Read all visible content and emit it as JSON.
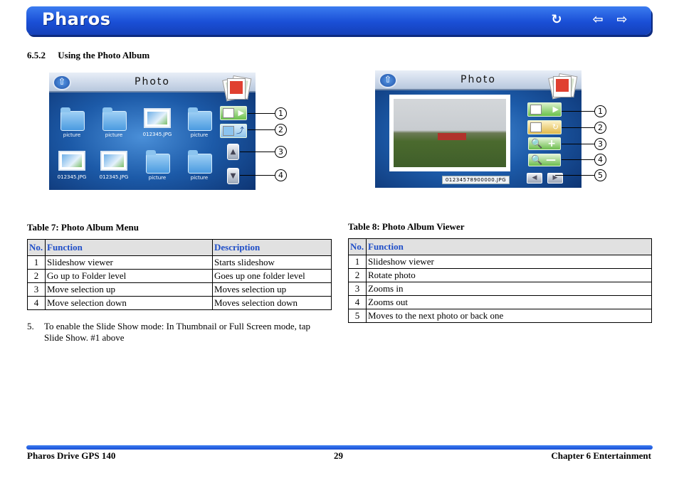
{
  "header": {
    "title": "Pharos",
    "icons": [
      "back-icon",
      "prev-page-icon",
      "next-page-icon"
    ]
  },
  "section": {
    "number": "6.5.2",
    "title": "Using the Photo Album"
  },
  "screen1": {
    "title": "Photo",
    "items": [
      {
        "type": "folder",
        "label": "picture"
      },
      {
        "type": "folder",
        "label": "picture"
      },
      {
        "type": "thumb",
        "label": "012345.JPG"
      },
      {
        "type": "folder",
        "label": "picture"
      },
      {
        "type": "thumb",
        "label": "012345.JPG"
      },
      {
        "type": "thumb",
        "label": "012345.JPG"
      },
      {
        "type": "folder",
        "label": "picture"
      },
      {
        "type": "folder",
        "label": "picture"
      }
    ],
    "callouts": [
      "1",
      "2",
      "3",
      "4"
    ]
  },
  "screen2": {
    "title": "Photo",
    "file_label": "01234578900000.JPG",
    "callouts": [
      "1",
      "2",
      "3",
      "4",
      "5"
    ]
  },
  "table7": {
    "caption": "Table 7: Photo Album Menu",
    "headers": [
      "No.",
      "Function",
      "Description"
    ],
    "rows": [
      [
        "1",
        "Slideshow viewer",
        "Starts slideshow"
      ],
      [
        "2",
        "Go up to Folder level",
        "Goes up one folder level"
      ],
      [
        "3",
        "Move selection up",
        "Moves selection up"
      ],
      [
        "4",
        "Move selection down",
        "Moves selection down"
      ]
    ]
  },
  "table8": {
    "caption": "Table 8: Photo Album Viewer",
    "headers": [
      "No.",
      "Function"
    ],
    "rows": [
      [
        "1",
        "Slideshow viewer"
      ],
      [
        "2",
        "Rotate photo"
      ],
      [
        "3",
        "Zooms in"
      ],
      [
        "4",
        "Zooms out"
      ],
      [
        "5",
        "Moves to the next photo or back one"
      ]
    ]
  },
  "note": {
    "number": "5.",
    "text": "To enable the Slide Show mode: In Thumbnail or Full Screen mode, tap Slide Show. #1 above"
  },
  "footer": {
    "left": "Pharos Drive GPS 140",
    "center": "29",
    "right": "Chapter 6 Entertainment"
  },
  "colors": {
    "header_blue": "#1a4fd6",
    "table_header_text": "#1f4ec8",
    "table_header_bg": "#e1e1e1"
  }
}
